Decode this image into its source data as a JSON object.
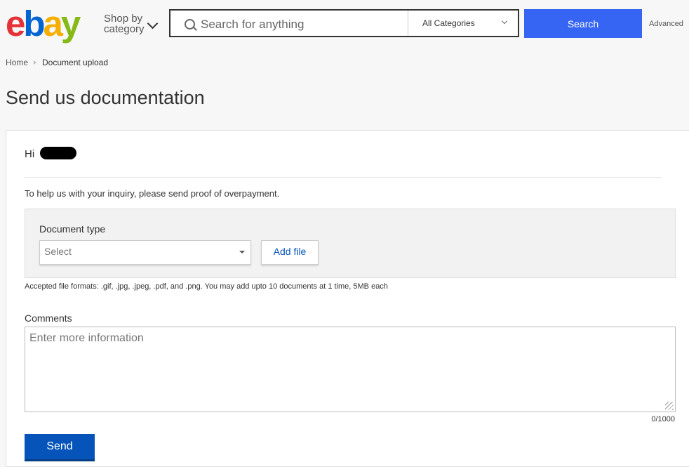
{
  "header": {
    "logo": {
      "e": "e",
      "b": "b",
      "a": "a",
      "y": "y"
    },
    "shop_by_line1": "Shop by",
    "shop_by_line2": "category",
    "search_placeholder": "Search for anything",
    "category_selected": "All Categories",
    "search_button": "Search",
    "advanced_link": "Advanced"
  },
  "breadcrumb": {
    "home": "Home",
    "current": "Document upload"
  },
  "page_title": "Send us documentation",
  "greeting": "Hi",
  "help_text": "To help us with your inquiry, please send proof of overpayment.",
  "document": {
    "type_label": "Document type",
    "select_value": "Select",
    "add_file_button": "Add file",
    "accepted_formats": "Accepted file formats: .gif, .jpg, .jpeg, .pdf, and .png. You may add upto 10 documents at 1 time, 5MB each"
  },
  "comments": {
    "label": "Comments",
    "placeholder": "Enter more information",
    "counter": "0/1000"
  },
  "send_button": "Send",
  "colors": {
    "search_button": "#3665f3",
    "send_button": "#0654ba",
    "link": "#0654ba"
  }
}
